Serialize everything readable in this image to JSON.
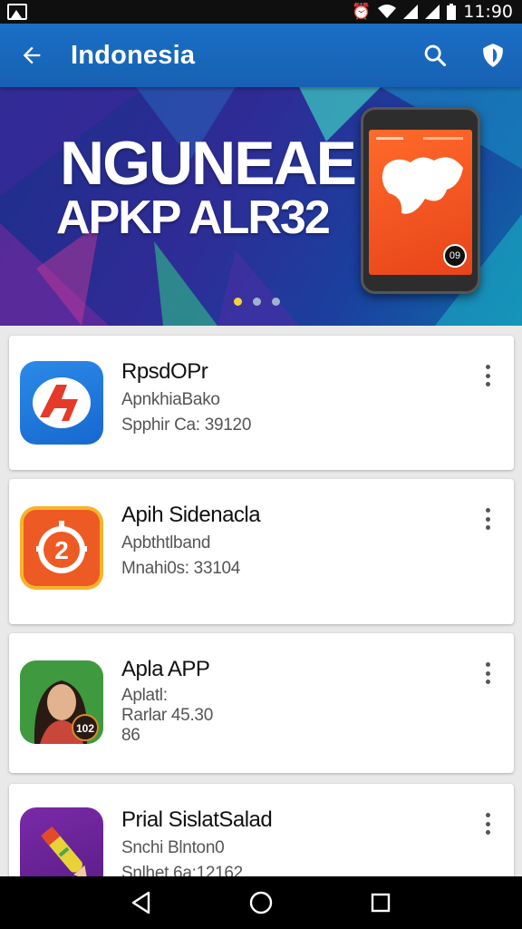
{
  "status_bar": {
    "time": "11:90",
    "icons": [
      "gallery-icon",
      "alarm-icon",
      "wifi-icon",
      "signal-icon",
      "signal-icon",
      "battery-icon"
    ]
  },
  "app_bar": {
    "title": "Indonesia",
    "back_icon": "arrow-left-icon",
    "search_icon": "search-icon",
    "shield_icon": "shield-icon"
  },
  "banner": {
    "title": "NGUNEAE",
    "subtitle": "APKP ALR32",
    "phone_badge": "09",
    "carousel_pages": 3,
    "carousel_active": 0
  },
  "apps": [
    {
      "title": "RpsdOPr",
      "line1": "ApnkhiaBako",
      "line2": "Spphir Ca: 39120",
      "line3": "",
      "icon": "red-arrow-app-icon"
    },
    {
      "title": "Apih Sidenacla",
      "line1": "Apbthtlband",
      "line2": "Mnahi0s: 33104",
      "line3": "",
      "icon": "orange-gear-app-icon"
    },
    {
      "title": "Apla APP",
      "line1": "Aplatl:",
      "line2": "Rarlar 45.30",
      "line3": "86",
      "icon": "person-photo-app-icon"
    },
    {
      "title": "Prial SislatSalad",
      "line1": "Snchi Blnton0",
      "line2": "Snlhet 6a:12162",
      "line3": "",
      "icon": "pen-app-icon"
    }
  ],
  "nav_bar": {
    "back": "back-triangle-icon",
    "home": "home-circle-icon",
    "recents": "recents-square-icon"
  },
  "colors": {
    "app_bar": "#1a6fc6",
    "banner_bg": "#2f2b95",
    "accent": "#f5d23c"
  }
}
